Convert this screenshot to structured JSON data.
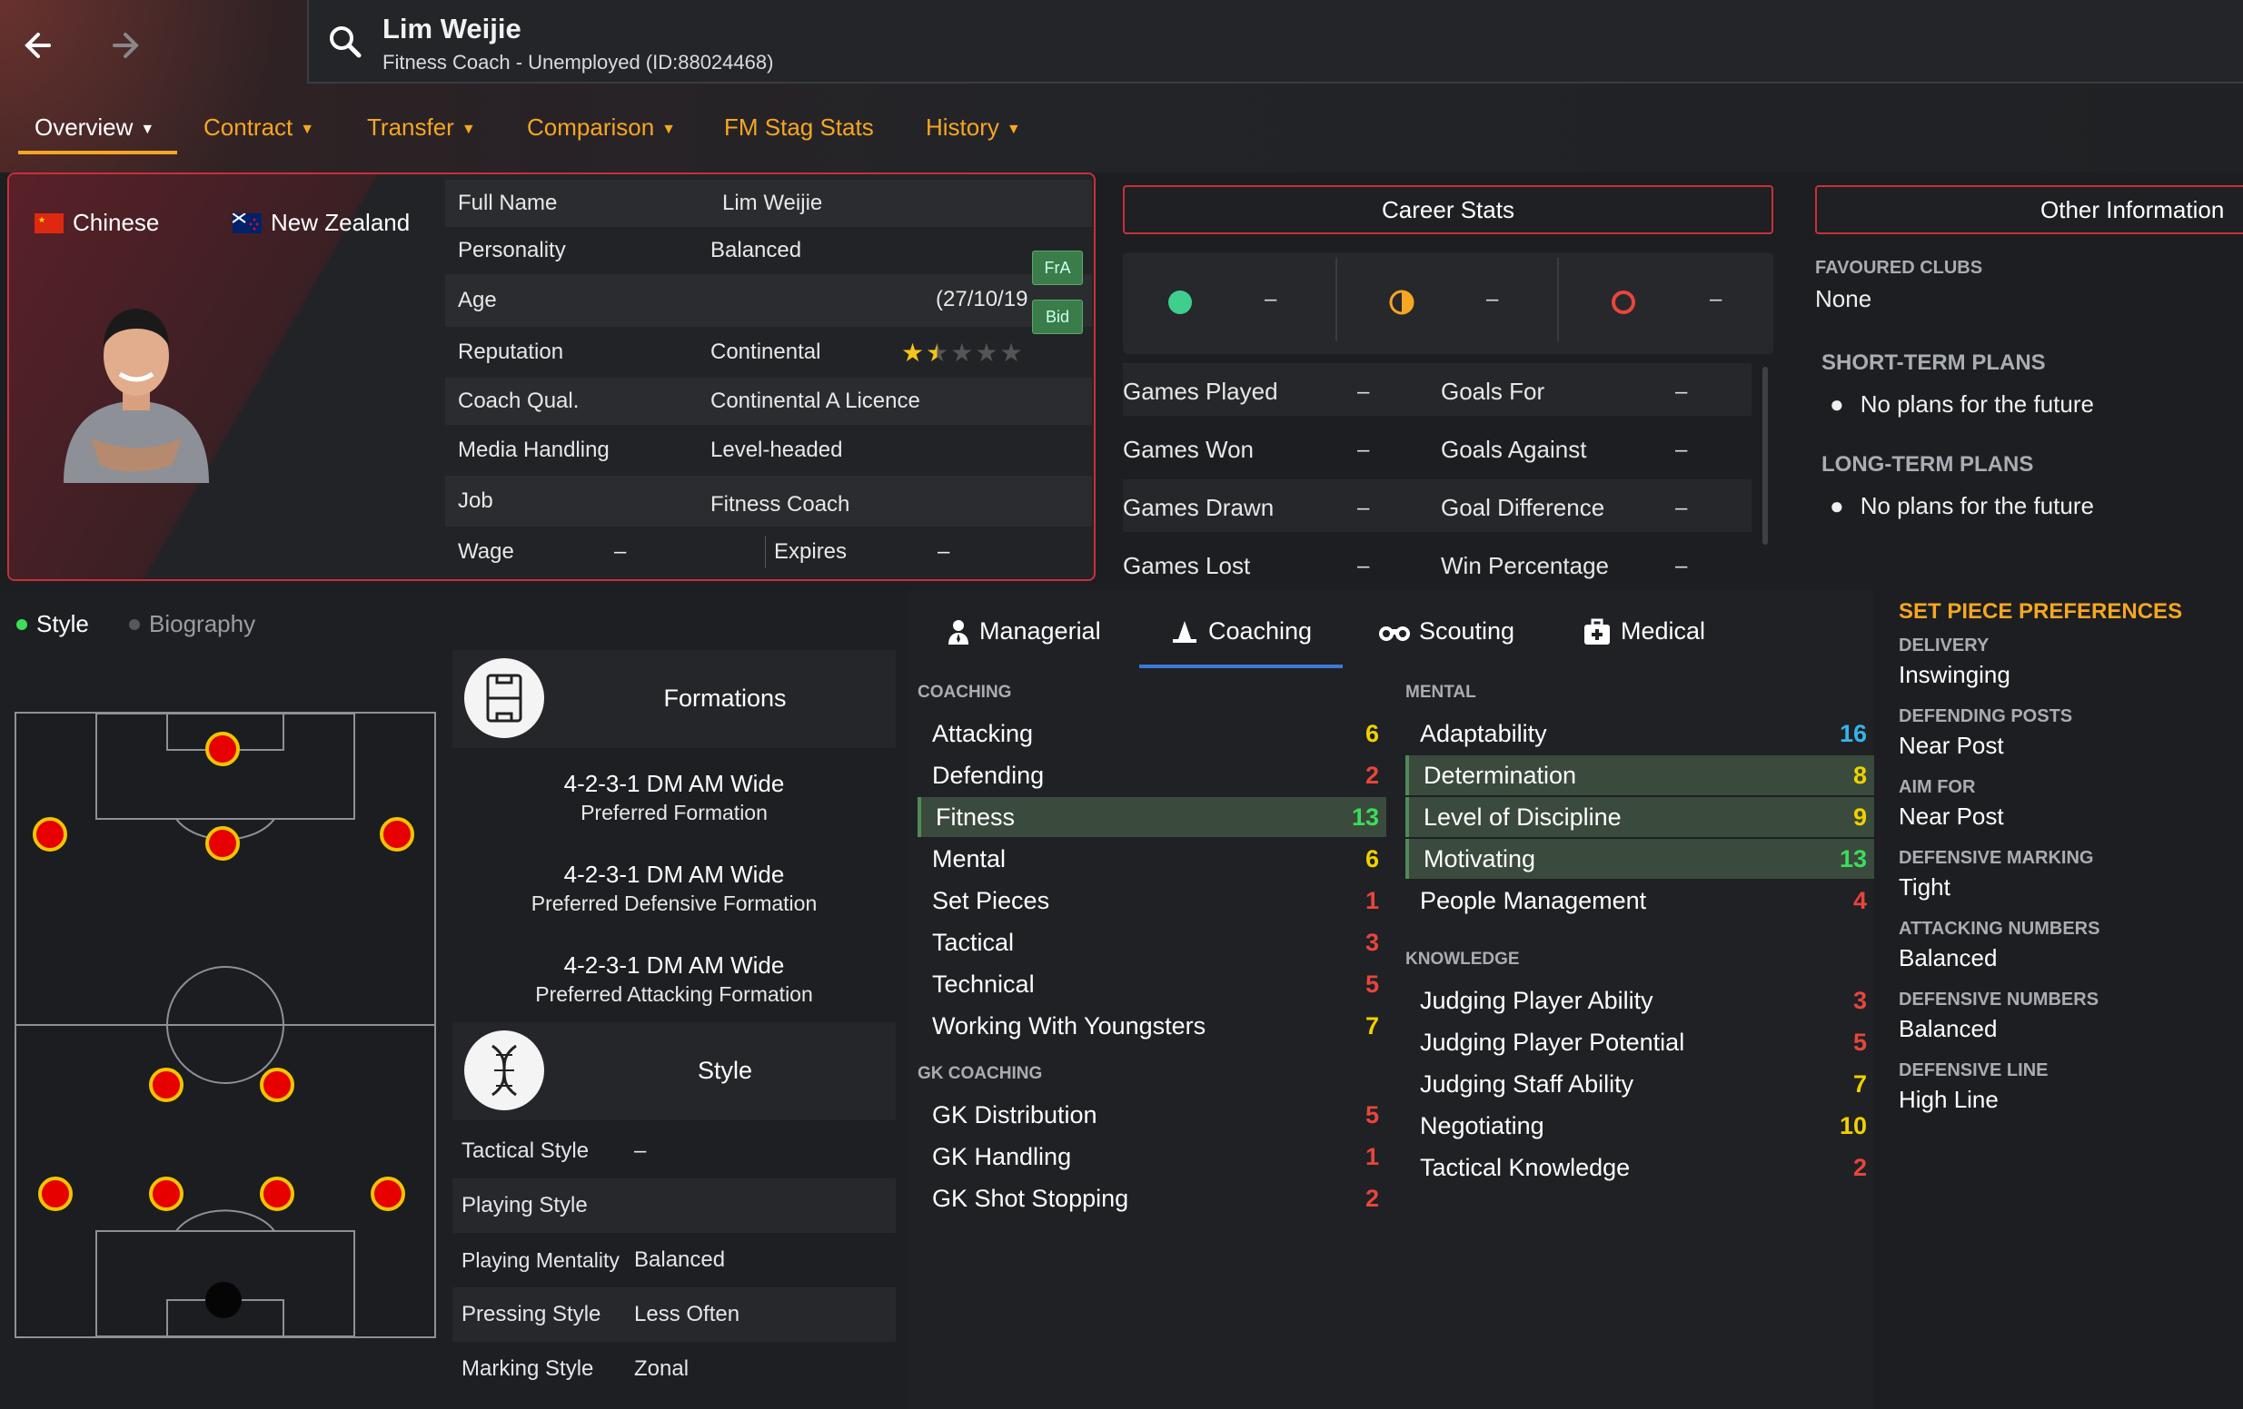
{
  "header": {
    "name": "Lim Weijie",
    "subtitle": "Fitness Coach - Unemployed (ID:88024468)"
  },
  "tabs": [
    {
      "label": "Overview",
      "has_menu": true
    },
    {
      "label": "Contract",
      "has_menu": true
    },
    {
      "label": "Transfer",
      "has_menu": true
    },
    {
      "label": "Comparison",
      "has_menu": true
    },
    {
      "label": "FM Stag Stats",
      "has_menu": false
    },
    {
      "label": "History",
      "has_menu": true
    }
  ],
  "profile": {
    "nation1": "Chinese",
    "nation2": "New Zealand",
    "rows": {
      "full_name": {
        "label": "Full Name",
        "value": "Lim Weijie"
      },
      "personality": {
        "label": "Personality",
        "value": "Balanced"
      },
      "age": {
        "label": "Age",
        "value": "(27/10/19"
      },
      "reputation": {
        "label": "Reputation",
        "value": "Continental",
        "stars": 1.5
      },
      "coach_qual": {
        "label": "Coach Qual.",
        "value": "Continental A Licence"
      },
      "media": {
        "label": "Media Handling",
        "value": "Level-headed"
      },
      "job": {
        "label": "Job",
        "value": "Fitness Coach"
      },
      "wage": {
        "label": "Wage",
        "value": "–"
      },
      "expires": {
        "label": "Expires",
        "value": "–"
      }
    },
    "badges": {
      "fra": "FrA",
      "bid": "Bid"
    }
  },
  "career": {
    "title": "Career Stats",
    "icon_values": [
      "–",
      "–",
      "–"
    ],
    "rows": [
      {
        "label": "Games Played",
        "value": "–",
        "label2": "Goals For",
        "value2": "–"
      },
      {
        "label": "Games Won",
        "value": "–",
        "label2": "Goals Against",
        "value2": "–"
      },
      {
        "label": "Games Drawn",
        "value": "–",
        "label2": "Goal Difference",
        "value2": "–"
      },
      {
        "label": "Games Lost",
        "value": "–",
        "label2": "Win Percentage",
        "value2": "–"
      }
    ]
  },
  "other": {
    "title": "Other Information",
    "favoured_label": "FAVOURED CLUBS",
    "favoured_value": "None",
    "short_label": "SHORT-TERM PLANS",
    "short_value": "No plans for the future",
    "long_label": "LONG-TERM PLANS",
    "long_value": "No plans for the future"
  },
  "subtabs": {
    "style": "Style",
    "biography": "Biography"
  },
  "formations": {
    "title": "Formations",
    "items": [
      {
        "name": "4-2-3-1 DM AM Wide",
        "caption": "Preferred Formation"
      },
      {
        "name": "4-2-3-1 DM AM Wide",
        "caption": "Preferred Defensive Formation"
      },
      {
        "name": "4-2-3-1 DM AM Wide",
        "caption": "Preferred Attacking Formation"
      }
    ]
  },
  "style": {
    "title": "Style",
    "rows": [
      {
        "label": "Tactical Style",
        "value": "–"
      },
      {
        "label": "Playing Style",
        "value": ""
      },
      {
        "label": "Playing Mentality",
        "value": "Balanced"
      },
      {
        "label": "Pressing Style",
        "value": "Less Often"
      },
      {
        "label": "Marking Style",
        "value": "Zonal"
      }
    ]
  },
  "coach_tabs": [
    "Managerial",
    "Coaching",
    "Scouting",
    "Medical"
  ],
  "coaching": {
    "section": "COACHING",
    "attrs": [
      {
        "name": "Attacking",
        "value": 6
      },
      {
        "name": "Defending",
        "value": 2
      },
      {
        "name": "Fitness",
        "value": 13
      },
      {
        "name": "Mental",
        "value": 6
      },
      {
        "name": "Set Pieces",
        "value": 1
      },
      {
        "name": "Tactical",
        "value": 3
      },
      {
        "name": "Technical",
        "value": 5
      },
      {
        "name": "Working With Youngsters",
        "value": 7
      }
    ],
    "gk_section": "GK COACHING",
    "gk_attrs": [
      {
        "name": "GK Distribution",
        "value": 5
      },
      {
        "name": "GK Handling",
        "value": 1
      },
      {
        "name": "GK Shot Stopping",
        "value": 2
      }
    ]
  },
  "mental": {
    "section": "MENTAL",
    "attrs": [
      {
        "name": "Adaptability",
        "value": 16
      },
      {
        "name": "Determination",
        "value": 8
      },
      {
        "name": "Level of Discipline",
        "value": 9
      },
      {
        "name": "Motivating",
        "value": 13
      },
      {
        "name": "People Management",
        "value": 4
      }
    ],
    "knowledge_section": "KNOWLEDGE",
    "knowledge_attrs": [
      {
        "name": "Judging Player Ability",
        "value": 3
      },
      {
        "name": "Judging Player Potential",
        "value": 5
      },
      {
        "name": "Judging Staff Ability",
        "value": 7
      },
      {
        "name": "Negotiating",
        "value": 10
      },
      {
        "name": "Tactical Knowledge",
        "value": 2
      }
    ]
  },
  "setpiece": {
    "title": "SET PIECE PREFERENCES",
    "items": [
      {
        "label": "DELIVERY",
        "value": "Inswinging"
      },
      {
        "label": "DEFENDING POSTS",
        "value": "Near Post"
      },
      {
        "label": "AIM FOR",
        "value": "Near Post"
      },
      {
        "label": "DEFENSIVE MARKING",
        "value": "Tight"
      },
      {
        "label": "ATTACKING NUMBERS",
        "value": "Balanced"
      },
      {
        "label": "DEFENSIVE NUMBERS",
        "value": "Balanced"
      },
      {
        "label": "DEFENSIVE LINE",
        "value": "High Line"
      }
    ]
  },
  "colors": {
    "accent": "#f5a623",
    "highlight_border": "#c8303a",
    "attr_red": "#e8453c",
    "attr_yellow": "#f0d000",
    "attr_green": "#3ddc5a",
    "attr_blue": "#35b3e8"
  }
}
